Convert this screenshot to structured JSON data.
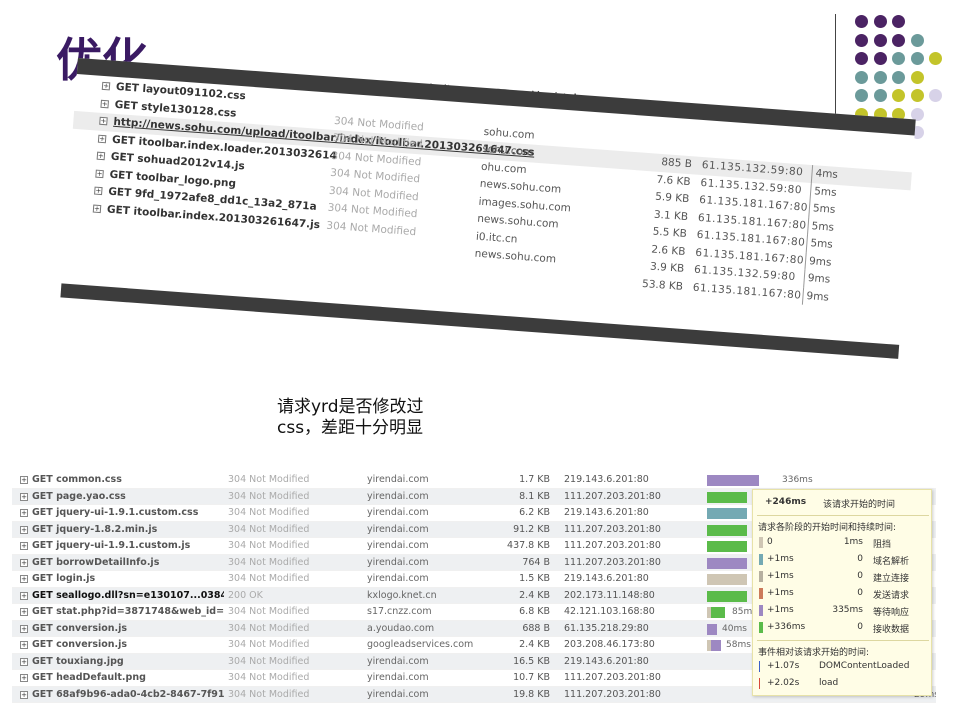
{
  "slide": {
    "title": "优化",
    "caption1_line1": "请求sohu是否修改过",
    "caption1_line2": "css",
    "caption2_line1": "请求yrd是否修改过",
    "caption2_line2": "css，差距十分明显"
  },
  "colors": {
    "title": "#3a1a63",
    "purple_dot": "#4b2364",
    "teal_dot": "#6b9a9a",
    "lime_dot": "#c3c42a",
    "lavender_dot": "#d7d2e8"
  },
  "sohu_requests": [
    {
      "name": "GET layout091102.css",
      "status": "",
      "domain": "",
      "size": "",
      "ip": "",
      "time": ""
    },
    {
      "name": "GET style130128.css",
      "status": "304 Not Modified",
      "domain": "sohu.com",
      "size": "",
      "ip": "",
      "time": ""
    },
    {
      "name": "http://news.sohu.com/upload/itoolbar/index/itoolbar.201303261647.css",
      "status": "304 Not Modified",
      "domain": "sohu.com",
      "size": "885 B",
      "ip": "61.135.132.59:80",
      "time": "4ms"
    },
    {
      "name": "GET itoolbar.index.loader.2013032614",
      "status": "304 Not Modified",
      "domain": "ohu.com",
      "size": "7.6 KB",
      "ip": "61.135.132.59:80",
      "time": "5ms"
    },
    {
      "name": "GET sohuad2012v14.js",
      "status": "304 Not Modified",
      "domain": "news.sohu.com",
      "size": "5.9 KB",
      "ip": "61.135.181.167:80",
      "time": "5ms"
    },
    {
      "name": "GET toolbar_logo.png",
      "status": "304 Not Modified",
      "domain": "images.sohu.com",
      "size": "3.1 KB",
      "ip": "61.135.181.167:80",
      "time": "5ms"
    },
    {
      "name": "GET 9fd_1972afe8_dd1c_13a2_871a",
      "status": "304 Not Modified",
      "domain": "news.sohu.com",
      "size": "5.5 KB",
      "ip": "61.135.181.167:80",
      "time": "5ms"
    },
    {
      "name": "GET itoolbar.index.201303261647.js",
      "status": "304 Not Modified",
      "domain": "i0.itc.cn",
      "size": "2.6 KB",
      "ip": "61.135.181.167:80",
      "time": "9ms"
    },
    {
      "name": "",
      "status": "",
      "domain": "news.sohu.com",
      "size": "3.9 KB",
      "ip": "61.135.132.59:80",
      "time": "9ms"
    },
    {
      "name": "",
      "status": "",
      "domain": "",
      "size": "53.8 KB",
      "ip": "61.135.181.167:80",
      "time": "9ms"
    }
  ],
  "yrd_requests": [
    {
      "name": "GET common.css",
      "status": "304 Not Modified",
      "domain": "yirendai.com",
      "size": "1.7 KB",
      "ip": "219.143.6.201:80",
      "timing": "336ms"
    },
    {
      "name": "GET page.yao.css",
      "status": "304 Not Modified",
      "domain": "yirendai.com",
      "size": "8.1 KB",
      "ip": "111.207.203.201:80",
      "timing": ""
    },
    {
      "name": "GET jquery-ui-1.9.1.custom.css",
      "status": "304 Not Modified",
      "domain": "yirendai.com",
      "size": "6.2 KB",
      "ip": "219.143.6.201:80",
      "timing": ""
    },
    {
      "name": "GET jquery-1.8.2.min.js",
      "status": "304 Not Modified",
      "domain": "yirendai.com",
      "size": "91.2 KB",
      "ip": "111.207.203.201:80",
      "timing": ""
    },
    {
      "name": "GET jquery-ui-1.9.1.custom.js",
      "status": "304 Not Modified",
      "domain": "yirendai.com",
      "size": "437.8 KB",
      "ip": "111.207.203.201:80",
      "timing": ""
    },
    {
      "name": "GET borrowDetailInfo.js",
      "status": "304 Not Modified",
      "domain": "yirendai.com",
      "size": "764 B",
      "ip": "111.207.203.201:80",
      "timing": ""
    },
    {
      "name": "GET login.js",
      "status": "304 Not Modified",
      "domain": "yirendai.com",
      "size": "1.5 KB",
      "ip": "219.143.6.201:80",
      "timing": ""
    },
    {
      "name": "GET seallogo.dll?sn=e130107...03844",
      "status": "200 OK",
      "domain": "kxlogo.knet.cn",
      "size": "2.4 KB",
      "ip": "202.173.11.148:80",
      "timing": ""
    },
    {
      "name": "GET stat.php?id=3871748&web_id=3",
      "status": "304 Not Modified",
      "domain": "s17.cnzz.com",
      "size": "6.8 KB",
      "ip": "42.121.103.168:80",
      "timing": "85m"
    },
    {
      "name": "GET conversion.js",
      "status": "304 Not Modified",
      "domain": "a.youdao.com",
      "size": "688 B",
      "ip": "61.135.218.29:80",
      "timing": "40ms"
    },
    {
      "name": "GET conversion.js",
      "status": "304 Not Modified",
      "domain": "googleadservices.com",
      "size": "2.4 KB",
      "ip": "203.208.46.173:80",
      "timing": "58ms"
    },
    {
      "name": "GET touxiang.jpg",
      "status": "304 Not Modified",
      "domain": "yirendai.com",
      "size": "16.5 KB",
      "ip": "219.143.6.201:80",
      "timing": ""
    },
    {
      "name": "GET headDefault.png",
      "status": "304 Not Modified",
      "domain": "yirendai.com",
      "size": "10.7 KB",
      "ip": "111.207.203.201:80",
      "timing": ""
    },
    {
      "name": "GET 68af9b96-ada0-4cb2-8467-7f91",
      "status": "304 Not Modified",
      "domain": "yirendai.com",
      "size": "19.8 KB",
      "ip": "111.207.203.201:80",
      "timing": "29ms"
    }
  ],
  "tooltip": {
    "start_value": "+246ms",
    "start_label": "该请求开始的时间",
    "phase_header": "请求各阶段的开始时间和持续时间:",
    "phases": [
      {
        "start": "0",
        "duration": "1ms",
        "label": "阻挡",
        "color": "#cfc6b4"
      },
      {
        "start": "+1ms",
        "duration": "0",
        "label": "域名解析",
        "color": "#74a9b3"
      },
      {
        "start": "+1ms",
        "duration": "0",
        "label": "建立连接",
        "color": "#b6b0a0"
      },
      {
        "start": "+1ms",
        "duration": "0",
        "label": "发送请求",
        "color": "#cc7a5a"
      },
      {
        "start": "+1ms",
        "duration": "335ms",
        "label": "等待响应",
        "color": "#9d88c2"
      },
      {
        "start": "+336ms",
        "duration": "0",
        "label": "接收数据",
        "color": "#5bbb4a"
      }
    ],
    "events_header": "事件相对该请求开始的时间:",
    "events": [
      {
        "time": "+1.07s",
        "label": "DOMContentLoaded",
        "color": "#3b5fc9"
      },
      {
        "time": "+2.02s",
        "label": "load",
        "color": "#d8473a"
      }
    ]
  }
}
